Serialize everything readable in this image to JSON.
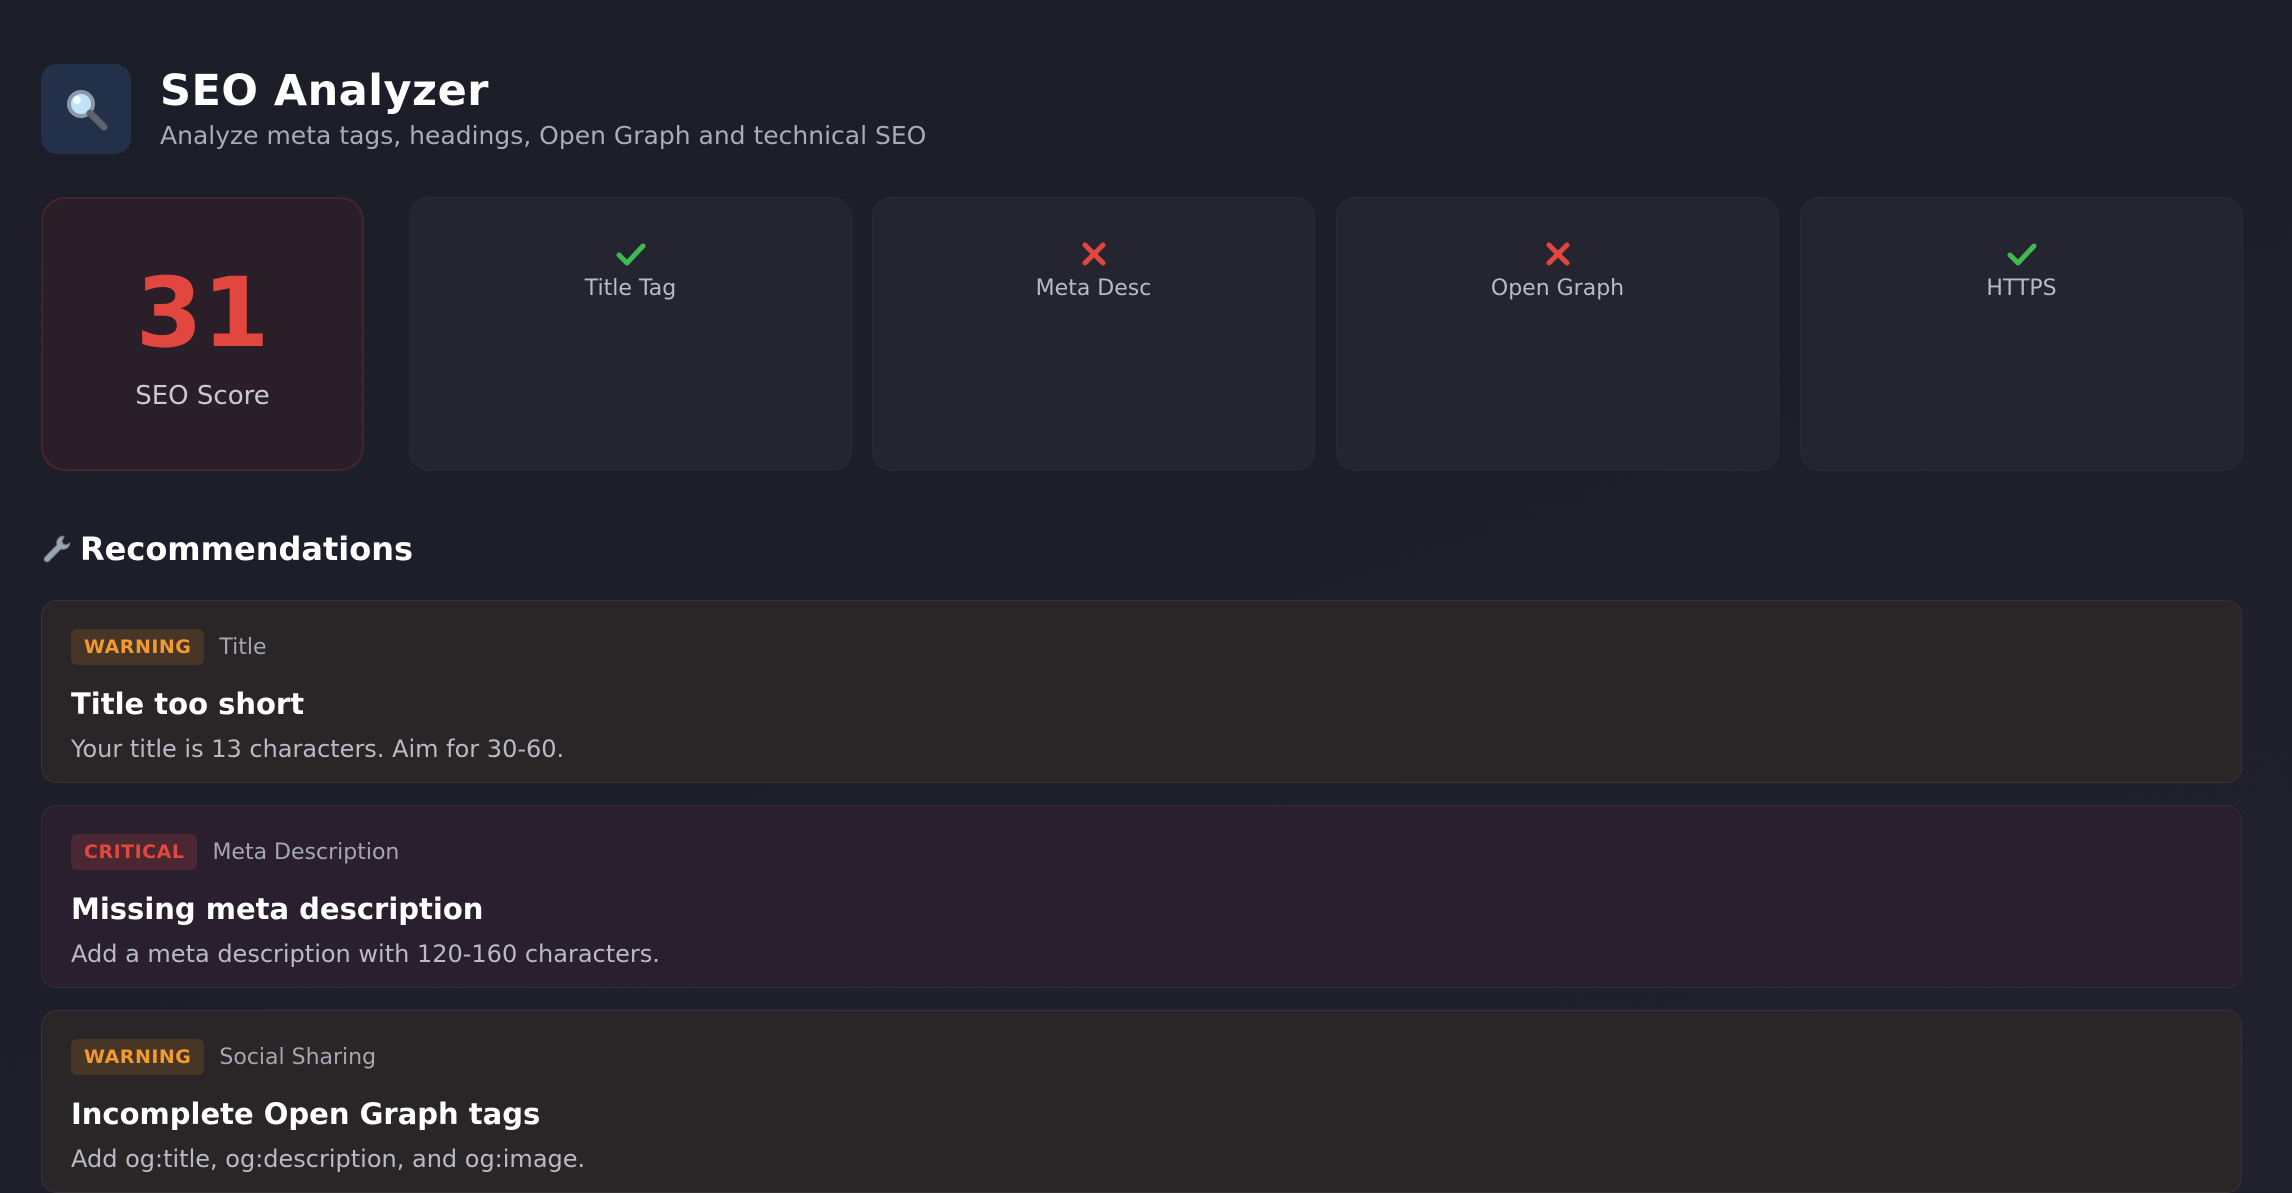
{
  "header": {
    "icon": "magnifier-icon",
    "title": "SEO Analyzer",
    "subtitle": "Analyze meta tags, headings, Open Graph and technical SEO"
  },
  "score": {
    "value": "31",
    "label": "SEO Score",
    "color": "#e2473f"
  },
  "checks": [
    {
      "label": "Title Tag",
      "status": "pass",
      "icon": "check-icon"
    },
    {
      "label": "Meta Desc",
      "status": "fail",
      "icon": "x-icon"
    },
    {
      "label": "Open Graph",
      "status": "fail",
      "icon": "x-icon"
    },
    {
      "label": "HTTPS",
      "status": "pass",
      "icon": "check-icon"
    }
  ],
  "recommendations": {
    "heading": "Recommendations",
    "icon": "wrench-icon",
    "items": [
      {
        "severity": "WARNING",
        "category": "Title",
        "title": "Title too short",
        "description": "Your title is 13 characters. Aim for 30-60."
      },
      {
        "severity": "CRITICAL",
        "category": "Meta Description",
        "title": "Missing meta description",
        "description": "Add a meta description with 120-160 characters."
      },
      {
        "severity": "WARNING",
        "category": "Social Sharing",
        "title": "Incomplete Open Graph tags",
        "description": "Add og:title, og:description, and og:image."
      }
    ]
  },
  "colors": {
    "pass": "#3fb950",
    "fail": "#e2473f",
    "warning": "#f39a2f",
    "critical": "#e2473f"
  }
}
